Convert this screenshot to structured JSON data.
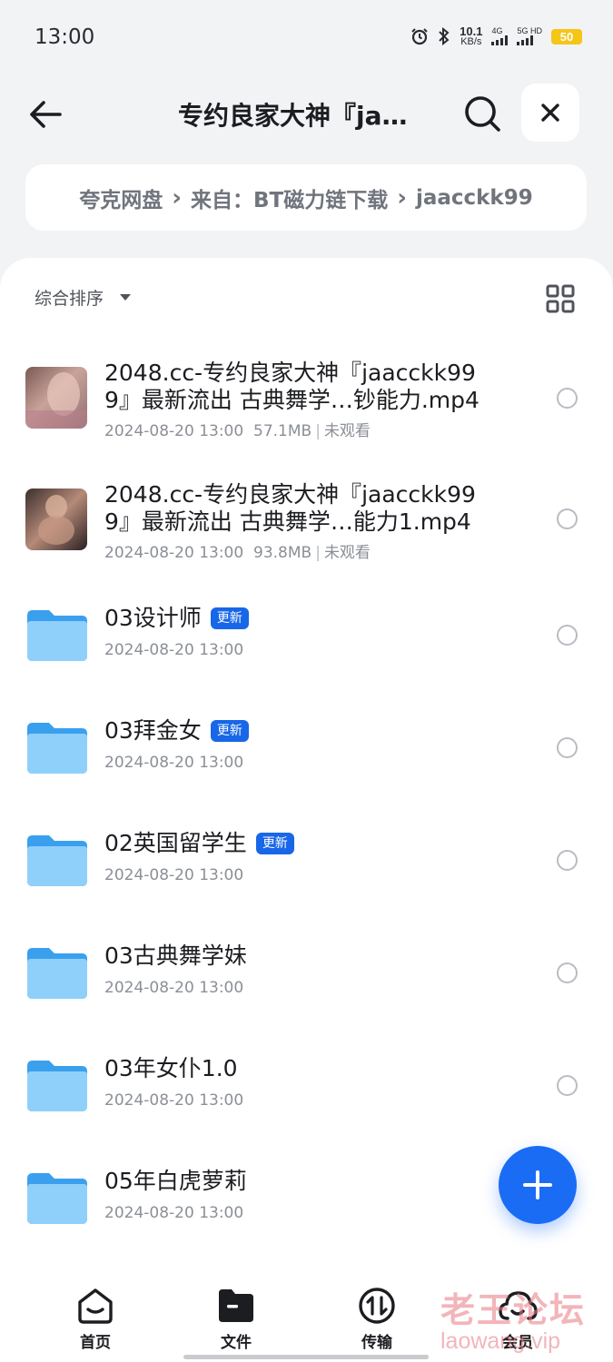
{
  "status_bar": {
    "time": "13:00",
    "net_speed": "10.1",
    "net_unit": "KB/s",
    "sig1_label": "4G",
    "sig2_label": "5G HD",
    "battery": "50"
  },
  "header": {
    "title": "专约良家大神『ja…"
  },
  "breadcrumb": [
    "夸克网盘",
    "来自：BT磁力链下载",
    "jaacckk99"
  ],
  "toolbar": {
    "sort_label": "综合排序"
  },
  "files": [
    {
      "type": "video",
      "name_line1": "2048.cc-专约良家大神『jaacckk99",
      "name_line2": "9』最新流出 古典舞学…钞能力.mp4",
      "date": "2024-08-20 13:00",
      "size": "57.1MB",
      "status": "未观看"
    },
    {
      "type": "video",
      "name_line1": "2048.cc-专约良家大神『jaacckk99",
      "name_line2": "9』最新流出 古典舞学…能力1.mp4",
      "date": "2024-08-20 13:00",
      "size": "93.8MB",
      "status": "未观看"
    },
    {
      "type": "folder",
      "name": "03设计师",
      "badge": "更新",
      "date": "2024-08-20 13:00"
    },
    {
      "type": "folder",
      "name": "03拜金女",
      "badge": "更新",
      "date": "2024-08-20 13:00"
    },
    {
      "type": "folder",
      "name": "02英国留学生",
      "badge": "更新",
      "date": "2024-08-20 13:00"
    },
    {
      "type": "folder",
      "name": "03古典舞学妹",
      "date": "2024-08-20 13:00"
    },
    {
      "type": "folder",
      "name": "03年女仆1.0",
      "date": "2024-08-20 13:00"
    },
    {
      "type": "folder",
      "name": "05年白虎萝莉",
      "date": "2024-08-20 13:00"
    }
  ],
  "bottom_nav": [
    {
      "label": "首页",
      "icon": "home-icon"
    },
    {
      "label": "文件",
      "icon": "folder-icon"
    },
    {
      "label": "传输",
      "icon": "transfer-icon"
    },
    {
      "label": "会员",
      "icon": "cloud-icon"
    }
  ],
  "watermark": {
    "text_cn": "老王论坛",
    "text_en": "laowang.vip"
  },
  "colors": {
    "accent": "#1a6cf5",
    "badge": "#1767e8",
    "folder": "#5cb5f5"
  }
}
